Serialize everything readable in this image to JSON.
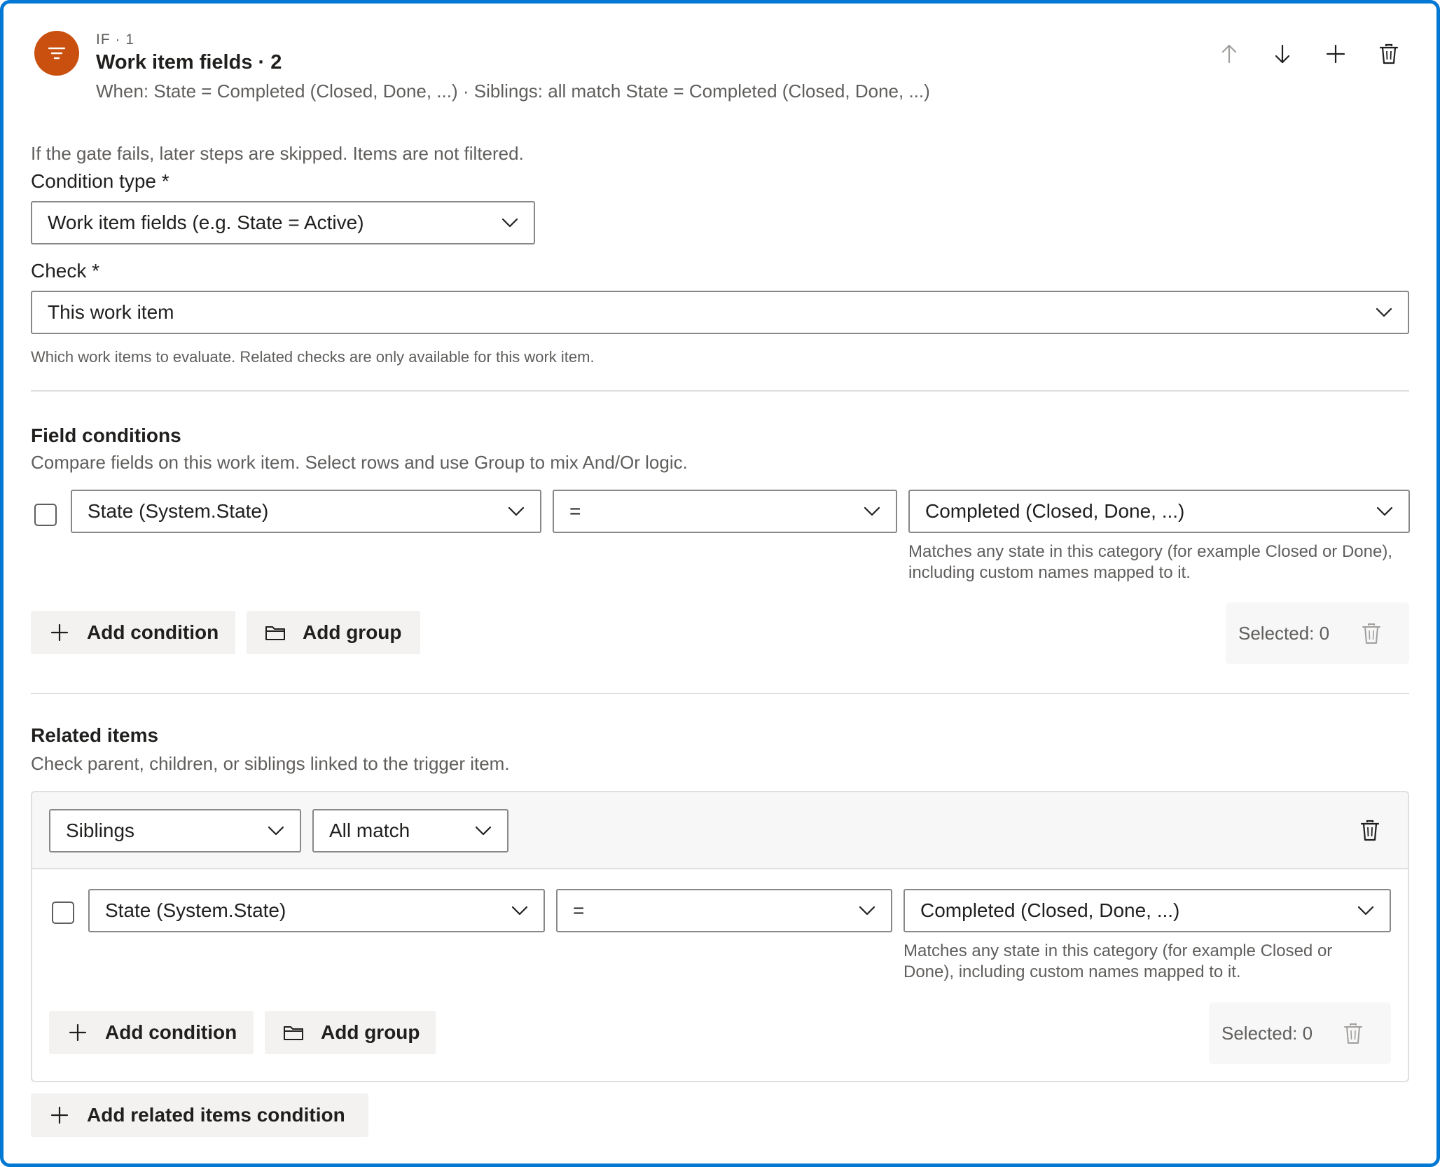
{
  "header": {
    "kicker": "IF · 1",
    "title": "Work item fields · 2",
    "summary": "When: State = Completed (Closed, Done, ...) · Siblings: all match State = Completed (Closed, Done, ...)",
    "icon": "filter-icon",
    "icon_color": "#ca5010",
    "actions": [
      "arrow-up-icon",
      "arrow-down-icon",
      "plus-icon",
      "trash-icon"
    ]
  },
  "gate_hint": "If the gate fails, later steps are skipped. Items are not filtered.",
  "condition_type": {
    "label": "Condition type *",
    "value": "Work item fields (e.g. State = Active)"
  },
  "check": {
    "label": "Check *",
    "value": "This work item",
    "help": "Which work items to evaluate. Related checks are only available for this work item."
  },
  "field_conditions": {
    "title": "Field conditions",
    "description": "Compare fields on this work item. Select rows and use Group to mix And/Or logic.",
    "row": {
      "field": "State (System.State)",
      "operator": "=",
      "value": "Completed (Closed, Done, ...)",
      "help": "Matches any state in this category (for example Closed or Done), including custom names mapped to it."
    },
    "add_condition": "Add condition",
    "add_group": "Add group",
    "selected": "Selected: 0"
  },
  "related_items": {
    "title": "Related items",
    "description": "Check parent, children, or siblings linked to the trigger item.",
    "relation": "Siblings",
    "match_mode": "All match",
    "row": {
      "field": "State (System.State)",
      "operator": "=",
      "value": "Completed (Closed, Done, ...)",
      "help": "Matches any state in this category (for example Closed or Done), including custom names mapped to it."
    },
    "add_condition": "Add condition",
    "add_group": "Add group",
    "selected": "Selected: 0",
    "add_related": "Add related items condition"
  },
  "colors": {
    "accent": "#0078d4",
    "step_icon": "#ca5010"
  }
}
